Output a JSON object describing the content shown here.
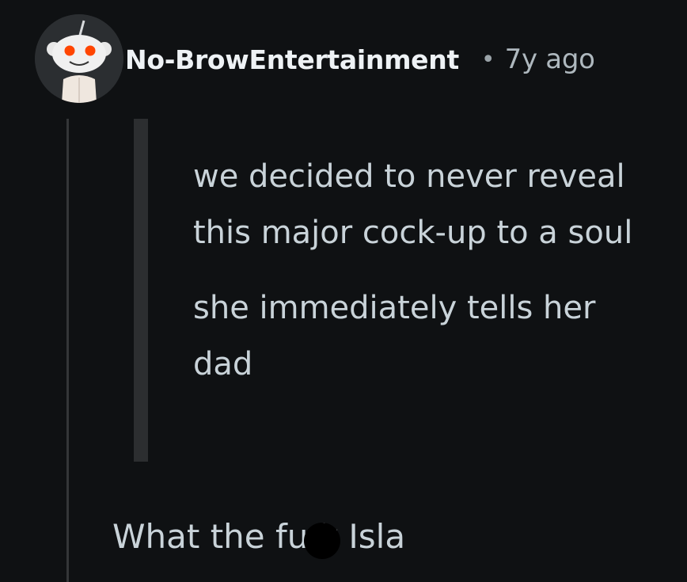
{
  "comment": {
    "author": "No-BrowEntertainment",
    "separator": "•",
    "age": "7y ago",
    "avatar_icon": "reddit-snoo-avatar-icon",
    "quote_lines": [
      "we decided to never reveal this major cock-up to a soul",
      "she immediately tells her dad"
    ],
    "body": "What the fu k Isla"
  },
  "colors": {
    "background": "#0f1113",
    "text": "#c9d3d9",
    "author": "#eef2f5",
    "meta": "#aeb8be",
    "quote_bar": "#2c2e30",
    "thread_line": "#343638"
  }
}
